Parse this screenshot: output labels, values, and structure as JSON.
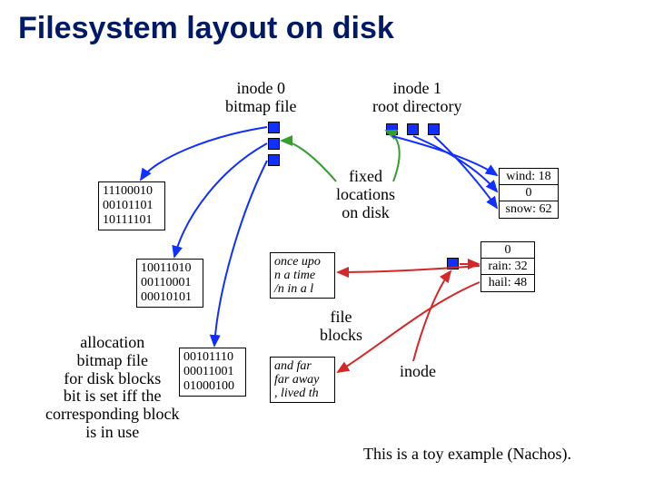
{
  "title": "Filesystem layout on disk",
  "labels": {
    "inode0": "inode 0\nbitmap file",
    "inode1": "inode 1\nroot directory",
    "fixed": "fixed\nlocations\non disk",
    "fileblocks": "file\nblocks",
    "alloc": "allocation\nbitmap file\nfor disk blocks\nbit is set iff the\ncorresponding block\nis in use",
    "inode_lbl": "inode"
  },
  "inode1_entries": {
    "e0": "wind: 18",
    "e1": "0",
    "e2": "snow: 62"
  },
  "inode_gen_entries": {
    "e0": "0",
    "e1": "rain: 32",
    "e2": "hail: 48"
  },
  "bitmap": {
    "b0": {
      "r0": "11100010",
      "r1": "00101101",
      "r2": "10111101"
    },
    "b1": {
      "r0": "10011010",
      "r1": "00110001",
      "r2": "00010101"
    },
    "b2": {
      "r0": "00101110",
      "r1": "00011001",
      "r2": "01000100"
    }
  },
  "fileblock": {
    "b0": {
      "r0": "once upo",
      "r1": "n a time",
      "r2": "/n in a l"
    },
    "b1": {
      "r0": "and far",
      "r1": "far away",
      "r2": ", lived th"
    }
  },
  "footnote": "This is a toy example (Nachos)."
}
